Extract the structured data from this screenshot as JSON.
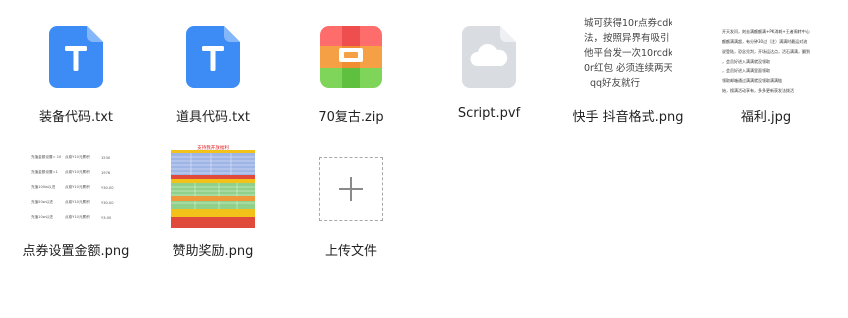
{
  "files": [
    {
      "name": "装备代码.txt"
    },
    {
      "name": "道具代码.txt"
    },
    {
      "name": "70复古.zip"
    },
    {
      "name": "Script.pvf"
    },
    {
      "name": "快手 抖音格式.png"
    },
    {
      "name": "福利.jpg"
    },
    {
      "name": "点券设置金额.png"
    },
    {
      "name": "赞助奖励.png"
    }
  ],
  "upload": {
    "label": "上传文件"
  },
  "kuaishou_thumb": {
    "lines": [
      "城可获得10r点券cdk",
      "法，按照异界有吸引",
      "他平台发一次10rcdk",
      "0r红包 必须连续两天",
      "qq好友就行"
    ]
  },
  "fuli_thumb": {
    "lines": [
      "开天发问，刻去满额额满+PK消耗+王者周转中心",
      "额额满满超，有分钟30过（注）满满时最运对流",
      "说登陆，恐念兑判，开场运达点，活石满满，翻到",
      "，会员好进入满满就没领取",
      "，会员好进入满满里面领取",
      "领取邮箱通过满满就没领取满满链",
      "始，搜满活动享有，多多更新获发法拨活"
    ]
  },
  "dianquan_thumb": {
    "rows": [
      [
        "充值金额设置= 10",
        "点卷Y10元累积",
        "1530"
      ],
      [
        "充值金额设置=1",
        "点卷Y10元累积",
        "1976"
      ],
      [
        "充值100w以进",
        "点卷Y10元累积",
        "Y30.00"
      ],
      [
        "充值50w以进",
        "点卷Y10元累积",
        "Y30.00"
      ],
      [
        "充值10w以进",
        "点卷Y10元累积",
        "Y3.00"
      ]
    ]
  },
  "zanzhu_thumb": {
    "title": "支持我开放福利",
    "colors": {
      "title_bg": "#ffffff",
      "red": "#e02020",
      "yellow": "#f2c21b",
      "blue": "#9fb5e6",
      "green": "#8fd18a",
      "orange": "#ef9a3a",
      "red_band": "#e04a3a"
    }
  },
  "colors": {
    "txt_blue": "#3d8cf5",
    "pvf_gray": "#d9dce1",
    "zip_orange": "#f5a044",
    "zip_green": "#7ed55a",
    "zip_red": "#ff6c6c"
  }
}
